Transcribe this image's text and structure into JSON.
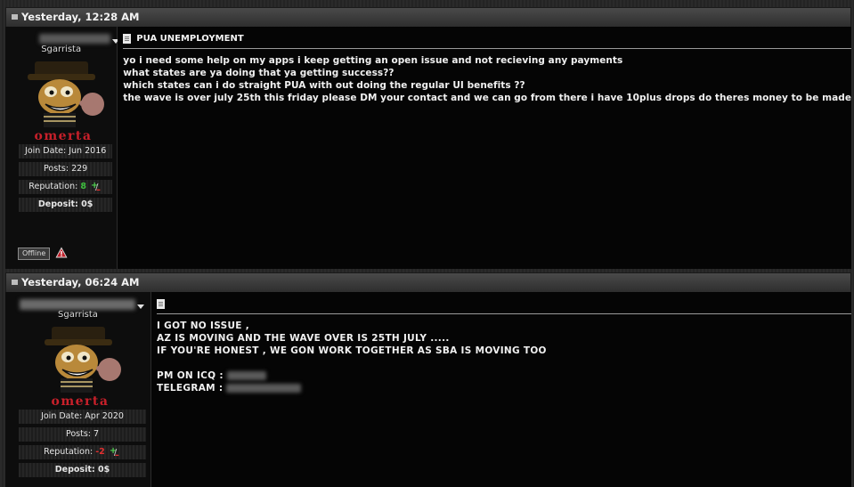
{
  "posts": [
    {
      "date": "Yesterday, 12:28 AM",
      "user_title": "Sgarrista",
      "avatar_text": "omerta",
      "join_date": "Join Date: Jun 2016",
      "posts": "Posts: 229",
      "reputation_label": "Reputation:",
      "reputation_value": "8",
      "deposit": "Deposit: 0$",
      "status": "Offline",
      "post_title": "PUA UNEMPLOYMENT",
      "message_lines": [
        "yo i need some help on my apps i keep getting an open issue and not recieving any payments",
        "what states are ya doing that ya getting success??",
        "which states can i do straight PUA with out doing the regular UI benefits ??",
        "the wave is over july 25th this friday please DM your contact and we can go from there i have 10plus drops do theres money to be made"
      ]
    },
    {
      "date": "Yesterday, 06:24 AM",
      "user_title": "Sgarrista",
      "avatar_text": "omerta",
      "join_date": "Join Date: Apr 2020",
      "posts": "Posts: 7",
      "reputation_label": "Reputation:",
      "reputation_value": "-2",
      "deposit": "Deposit: 0$",
      "post_title": "",
      "message_lines": [
        "I GOT NO ISSUE ,",
        "AZ IS MOVING AND THE WAVE OVER IS 25TH JULY .....",
        "IF YOU'RE HONEST , WE GON WORK TOGETHER AS SBA IS MOVING TOO"
      ],
      "contact_icq_label": "PM ON ICQ :",
      "contact_telegram_label": "TELEGRAM :"
    }
  ],
  "colors": {
    "header_bg": "#3a3a3a",
    "rep_positive": "#3fbf3f",
    "rep_negative": "#e03030",
    "avatar_text": "#c8202a"
  },
  "icons": [
    "header-bullet-icon",
    "user-menu-caret-icon",
    "document-icon",
    "reputation-icon",
    "report-warning-icon"
  ]
}
